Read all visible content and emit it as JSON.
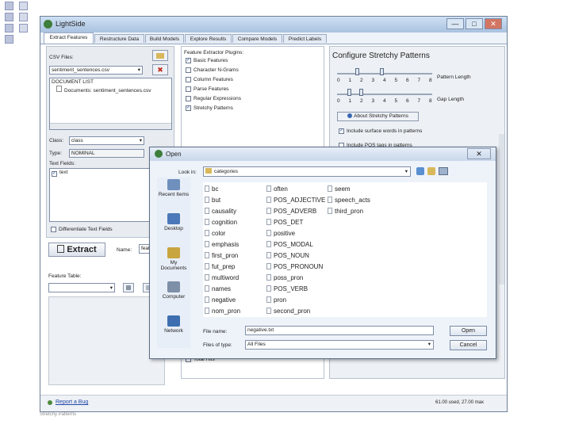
{
  "app": {
    "title": "LightSide"
  },
  "window_controls": {
    "minimize": "—",
    "maximize": "□",
    "close": "✕"
  },
  "tabs": [
    {
      "label": "Extract Features"
    },
    {
      "label": "Restructure Data"
    },
    {
      "label": "Build Models"
    },
    {
      "label": "Explore Results"
    },
    {
      "label": "Compare Models"
    },
    {
      "label": "Predict Labels"
    }
  ],
  "left_panel": {
    "csv_label": "CSV Files:",
    "csv_selected": "sentiment_sentences.csv",
    "doc_list_header": "DOCUMENT LIST",
    "doc_item": "Documents: sentiment_sentences.csv",
    "class_label": "Class:",
    "class_value": "class",
    "type_label": "Type:",
    "type_value": "NOMINAL",
    "text_fields_label": "Text Fields:",
    "text_field_item": "text",
    "differentiate_label": "Differentiate Text Fields",
    "extract_button": "Extract",
    "name_label": "Name:",
    "name_value": "feat",
    "feature_table_label": "Feature Table:"
  },
  "plugins": {
    "header": "Feature Extractor Plugins:",
    "items": [
      {
        "label": "Basic Features",
        "checked": true
      },
      {
        "label": "Character N-Grams",
        "checked": false
      },
      {
        "label": "Column Features",
        "checked": false
      },
      {
        "label": "Parse Features",
        "checked": false
      },
      {
        "label": "Regular Expressions",
        "checked": false
      },
      {
        "label": "Stretchy Patterns",
        "checked": true
      }
    ],
    "partial_item": "Total Hits"
  },
  "stretchy": {
    "title": "Configure Stretchy Patterns",
    "pattern_length_label": "Pattern Length",
    "gap_length_label": "Gap Length",
    "ticks1": [
      "0",
      "1",
      "2",
      "3",
      "4",
      "5",
      "6",
      "7",
      "8"
    ],
    "ticks2": [
      "0",
      "1",
      "2",
      "3",
      "4",
      "5",
      "6",
      "7",
      "8"
    ],
    "about_button": "About Stretchy Patterns",
    "opt1": "Include surface words in patterns",
    "opt2": "Include POS tags in patterns"
  },
  "status": {
    "report_bug": "Report a Bug",
    "memory": "61.00 used, 27.00 max"
  },
  "slide_footer": "Stretchy Patterns"
}
